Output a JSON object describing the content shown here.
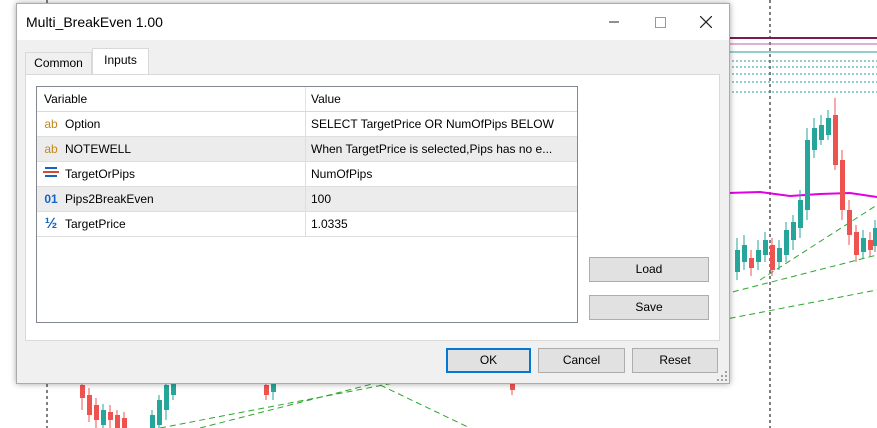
{
  "window": {
    "title": "Multi_BreakEven 1.00",
    "minimize_icon": "minimize-icon",
    "maximize_icon": "maximize-icon",
    "close_icon": "close-icon"
  },
  "tabs": [
    {
      "label": "Common",
      "active": false
    },
    {
      "label": "Inputs",
      "active": true
    }
  ],
  "grid": {
    "headers": {
      "variable": "Variable",
      "value": "Value"
    },
    "rows": [
      {
        "icon": "ab",
        "icon_name": "string-type-icon",
        "name": "Option",
        "value": "SELECT TargetPrice OR NumOfPips BELOW"
      },
      {
        "icon": "ab",
        "icon_name": "string-type-icon",
        "name": "NOTEWELL",
        "value": "When TargetPrice is selected,Pips has no e..."
      },
      {
        "icon": "",
        "icon_name": "enum-type-icon",
        "name": "TargetOrPips",
        "value": "NumOfPips"
      },
      {
        "icon": "01",
        "icon_name": "integer-type-icon",
        "name": "Pips2BreakEven",
        "value": "100"
      },
      {
        "icon": "½",
        "icon_name": "double-type-icon",
        "name": "TargetPrice",
        "value": "1.0335"
      }
    ]
  },
  "side_buttons": {
    "load": "Load",
    "save": "Save"
  },
  "footer_buttons": {
    "ok": "OK",
    "cancel": "Cancel",
    "reset": "Reset"
  },
  "colors": {
    "chart_up": "#26a69a",
    "chart_down": "#ef5350",
    "chart_ma": "#e000e0",
    "chart_level": "#7b1b4f",
    "chart_dashed_green": "#2ea62e",
    "chart_dotted_teal": "#2a9d9a"
  }
}
